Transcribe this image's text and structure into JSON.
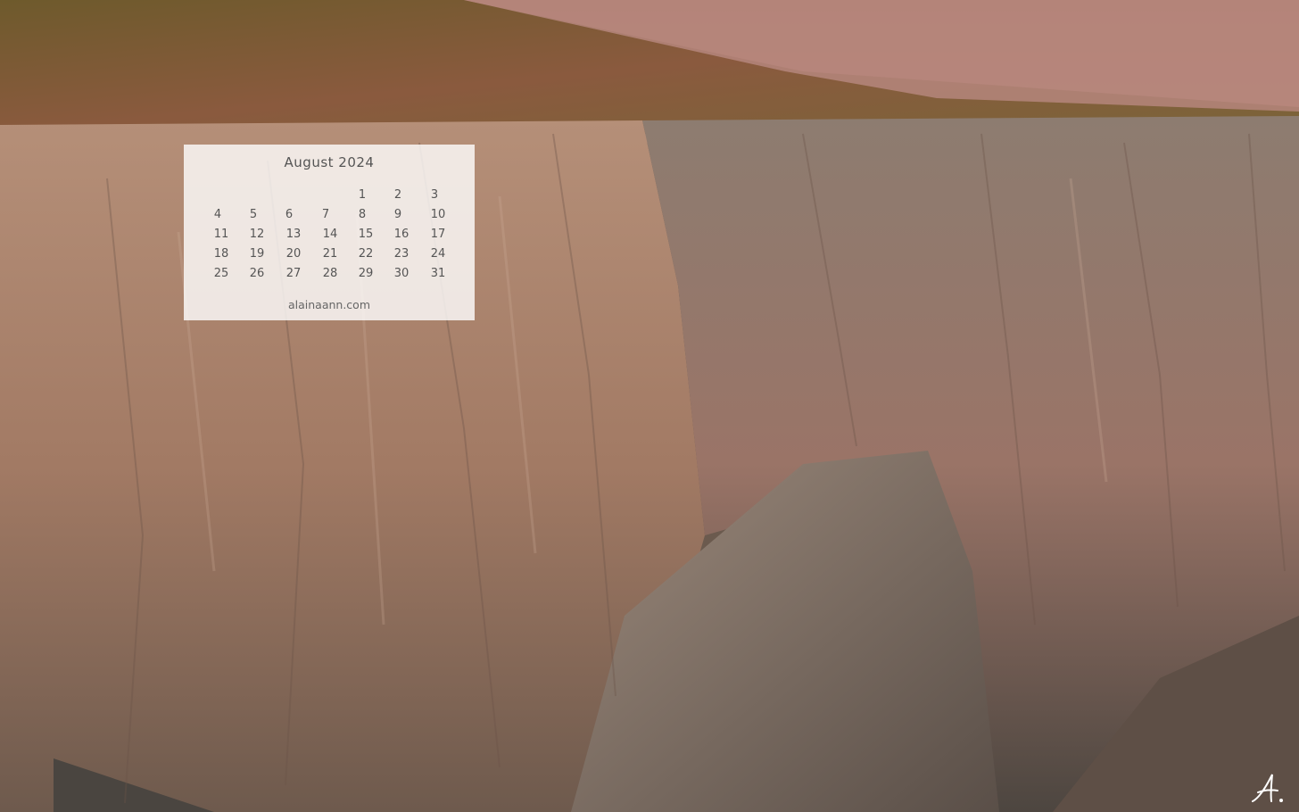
{
  "calendar": {
    "title": "August 2024",
    "weeks": [
      [
        "",
        "",
        "",
        "",
        "1",
        "2",
        "3"
      ],
      [
        "4",
        "5",
        "6",
        "7",
        "8",
        "9",
        "10"
      ],
      [
        "11",
        "12",
        "13",
        "14",
        "15",
        "16",
        "17"
      ],
      [
        "18",
        "19",
        "20",
        "21",
        "22",
        "23",
        "24"
      ],
      [
        "25",
        "26",
        "27",
        "28",
        "29",
        "30",
        "31"
      ]
    ],
    "website": "alainaann.com"
  },
  "signature": {
    "text": "A."
  },
  "background": {
    "subject": "canyon cliffs landscape photograph"
  }
}
